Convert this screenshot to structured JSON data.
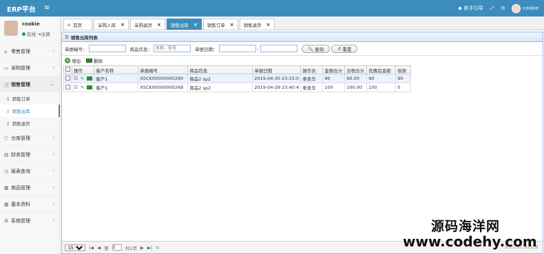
{
  "topbar": {
    "title": "ERP平台",
    "guide": "新手引导",
    "user": "cookie"
  },
  "user": {
    "name": "cookie",
    "status": "在线",
    "logout": "注销"
  },
  "menu": [
    {
      "label": "零售管理",
      "icon": "shop-icon"
    },
    {
      "label": "采购管理",
      "icon": "monitor-icon"
    },
    {
      "label": "销售管理",
      "icon": "cart-icon"
    },
    {
      "label": "仓库管理",
      "icon": "cube-icon"
    },
    {
      "label": "财务管理",
      "icon": "book-icon"
    },
    {
      "label": "报表查询",
      "icon": "clock-icon"
    },
    {
      "label": "商品管理",
      "icon": "goods-icon"
    },
    {
      "label": "基本资料",
      "icon": "grid-icon"
    },
    {
      "label": "系统管理",
      "icon": "gear-icon"
    }
  ],
  "submenu": [
    "销售订单",
    "销售出库",
    "销售退货"
  ],
  "tabs": [
    "首页",
    "采购入库",
    "采购退货",
    "销售出库",
    "销售订单",
    "销售退货"
  ],
  "panel": {
    "title": "销售出库列表"
  },
  "search": {
    "no_label": "单据编号：",
    "goods_label": "商品信息：",
    "goods_placeholder": "名称，型号",
    "date_label": "单据日期：",
    "sep": "-",
    "query": "查询",
    "reset": "重置"
  },
  "toolbar": {
    "add": "增加",
    "delete": "删除"
  },
  "table": {
    "headers": [
      "操作",
      "客户名称",
      "单据编号",
      "商品信息",
      "单据日期",
      "操作员",
      "金额合计",
      "含税合计",
      "优惠后金额",
      "收款"
    ],
    "rows": [
      [
        "客户1",
        "XSCK00000000290",
        "商品2 sp2",
        "2019-04-30 23:15:0",
        "季圣华",
        "90",
        "90.00",
        "90",
        "90"
      ],
      [
        "客户1",
        "XSCK00000000268",
        "商品2 sp2",
        "2019-04-29 23:40:4",
        "季圣华",
        "100",
        "100.00",
        "100",
        "0"
      ]
    ]
  },
  "pager": {
    "size": "15",
    "page_label": "第",
    "page": "1",
    "total": "共1页",
    "info": "显示1到2,共2记录"
  },
  "watermark": {
    "line1": "源码海洋网",
    "line2": "www.codehy.com"
  }
}
